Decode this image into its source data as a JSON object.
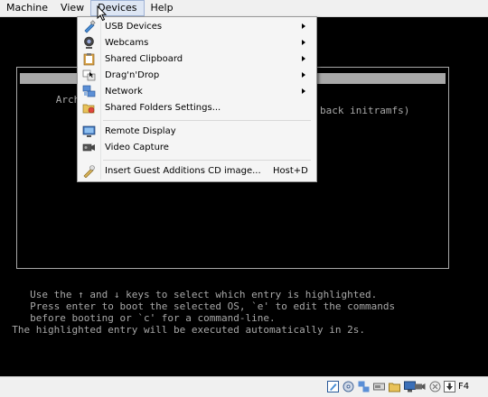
{
  "menubar": {
    "items": [
      {
        "label": "Machine"
      },
      {
        "label": "View"
      },
      {
        "label": "Devices"
      },
      {
        "label": "Help"
      }
    ]
  },
  "devices_menu": {
    "items": [
      {
        "label": "USB Devices",
        "icon": "usb-icon",
        "submenu": true
      },
      {
        "label": "Webcams",
        "icon": "webcam-icon",
        "submenu": true
      },
      {
        "label": "Shared Clipboard",
        "icon": "clipboard-icon",
        "submenu": true
      },
      {
        "label": "Drag'n'Drop",
        "icon": "drag-drop-icon",
        "submenu": true
      },
      {
        "label": "Network",
        "icon": "network-icon",
        "submenu": true
      },
      {
        "label": "Shared Folders Settings...",
        "icon": "shared-folders-icon",
        "submenu": false
      },
      {
        "label": "Remote Display",
        "icon": "remote-display-icon",
        "submenu": false
      },
      {
        "label": "Video Capture",
        "icon": "video-capture-icon",
        "submenu": false
      },
      {
        "label": "Insert Guest Additions CD image...",
        "icon": "cd-icon",
        "submenu": false,
        "shortcut": "Host+D"
      }
    ]
  },
  "boot_menu": {
    "entries": [
      {
        "visible_text": "Arch GNU/L",
        "selected": true
      },
      {
        "visible_text": "Arch GNU/L",
        "tail_text": "back initramfs)",
        "selected": false
      }
    ],
    "help_lines": [
      "     Use the ↑ and ↓ keys to select which entry is highlighted.",
      "     Press enter to boot the selected OS, `e' to edit the commands",
      "     before booting or `c' for a command-line.",
      "  The highlighted entry will be executed automatically in 2s."
    ]
  },
  "statusbar": {
    "host_key": "F4"
  },
  "colors": {
    "console_text": "#a8a8a8",
    "menu_bg": "#f5f5f5",
    "active_menu_bg": "#dde6f4"
  }
}
